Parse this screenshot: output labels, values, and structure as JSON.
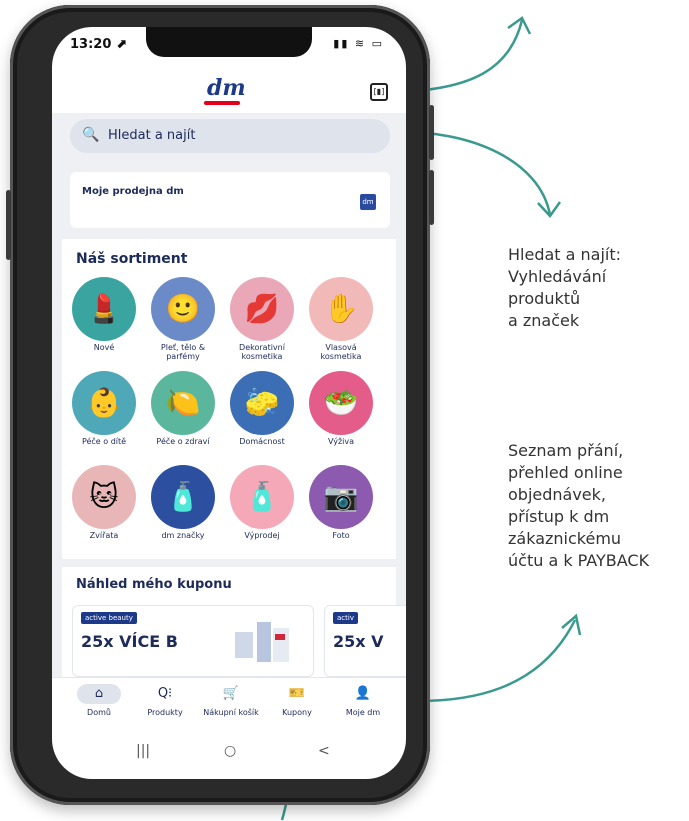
{
  "status_bar": {
    "time": "13:20 ⬈",
    "icons": "▮▮ ≋ ▭"
  },
  "app": {
    "logo": "dm",
    "search_placeholder": "Hledat a najít",
    "store_card_label": "Moje prodejna dm",
    "assortment_title": "Náš sortiment",
    "categories": [
      {
        "label": "Nové",
        "icon": "makeup-icon",
        "color": "#3aa5a0",
        "glyph": "💄"
      },
      {
        "label": "Pleť, tělo & parfémy",
        "icon": "face-icon",
        "color": "#6a8ac8",
        "glyph": "🙂"
      },
      {
        "label": "Dekorativní kosmetika",
        "icon": "lipstick-icon",
        "color": "#e9a7b8",
        "glyph": "💋"
      },
      {
        "label": "Vlasová kosmetika",
        "icon": "hair-icon",
        "color": "#f2b9b9",
        "glyph": "✋"
      },
      {
        "label": "Péče o dítě",
        "icon": "baby-icon",
        "color": "#4fa8b8",
        "glyph": "👶"
      },
      {
        "label": "Péče o zdraví",
        "icon": "health-icon",
        "color": "#5ab79d",
        "glyph": "🍋"
      },
      {
        "label": "Domácnost",
        "icon": "household-icon",
        "color": "#3b6eb4",
        "glyph": "🧽"
      },
      {
        "label": "Výživa",
        "icon": "food-icon",
        "color": "#e45c8a",
        "glyph": "🥗"
      },
      {
        "label": "Zvířata",
        "icon": "pets-icon",
        "color": "#e8b6b6",
        "glyph": "🐱"
      },
      {
        "label": "dm značky",
        "icon": "brands-icon",
        "color": "#2d4fa0",
        "glyph": "🧴"
      },
      {
        "label": "Výprodej",
        "icon": "sale-icon",
        "color": "#f4a8b8",
        "glyph": "🧴"
      },
      {
        "label": "Foto",
        "icon": "photo-icon",
        "color": "#8c5bb0",
        "glyph": "📷"
      }
    ],
    "coupon_title": "Náhled mého kuponu",
    "coupons": [
      {
        "badge": "active beauty",
        "text": "25x VÍCE B"
      },
      {
        "badge": "activ",
        "text": "25x V"
      }
    ],
    "tabs": [
      {
        "label": "Domů",
        "icon": "home-icon",
        "glyph": "⌂"
      },
      {
        "label": "Produkty",
        "icon": "products-icon",
        "glyph": "Q⁝"
      },
      {
        "label": "Nákupní košík",
        "icon": "cart-icon",
        "glyph": "🛒"
      },
      {
        "label": "Kupony",
        "icon": "coupon-icon",
        "glyph": "🎫"
      },
      {
        "label": "Moje dm",
        "icon": "user-icon",
        "glyph": "👤"
      }
    ],
    "android_nav": {
      "recents": "|||",
      "home": "○",
      "back": "<"
    }
  },
  "annotations": {
    "search": [
      "Hledat a najít:",
      "Vyhledávání",
      "produktů",
      "a značek"
    ],
    "tabs": [
      "Seznam přání,",
      "přehled online",
      "objednávek,",
      "přístup k dm",
      "zákaznickému",
      "účtu a k PAYBACK"
    ]
  },
  "colors": {
    "arrow": "#3a9a8e",
    "brand_blue": "#1d3a8a",
    "brand_red": "#e2001a"
  }
}
